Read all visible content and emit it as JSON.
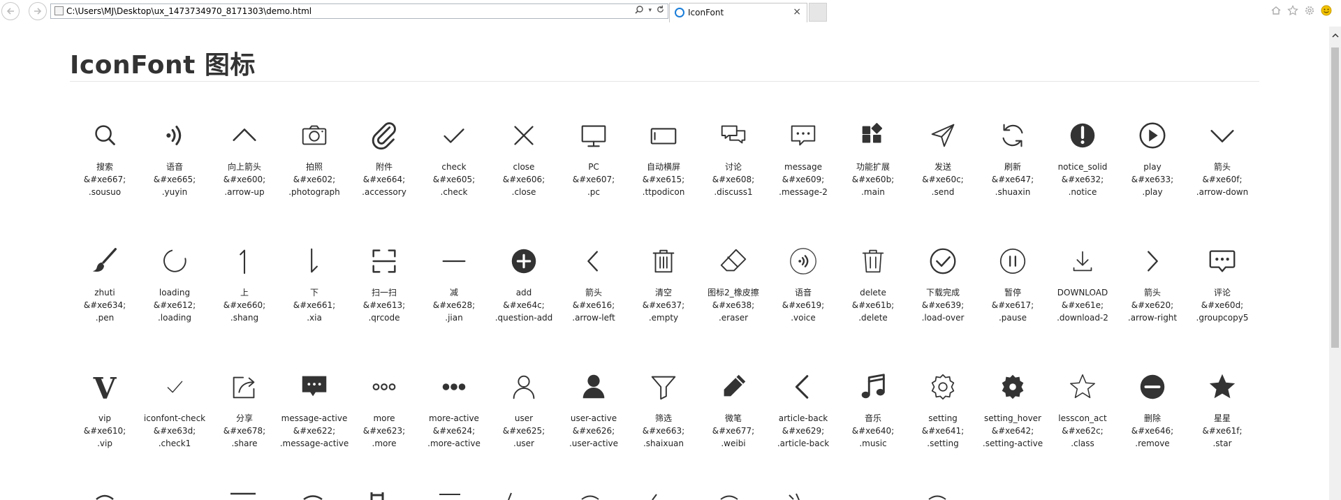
{
  "browser": {
    "address": "C:\\Users\\MJ\\Desktop\\ux_1473734970_8171303\\demo.html",
    "tab_title": "IconFont",
    "tab_close": "×"
  },
  "page": {
    "title": "IconFont 图标"
  },
  "icons": [
    {
      "name": "搜索",
      "code": "&#xe667;",
      "cls": ".sousuo",
      "icon": "search"
    },
    {
      "name": "语音",
      "code": "&#xe665;",
      "cls": ".yuyin",
      "icon": "voice-waves"
    },
    {
      "name": "向上箭头",
      "code": "&#xe600;",
      "cls": ".arrow-up",
      "icon": "arrow-up"
    },
    {
      "name": "拍照",
      "code": "&#xe602;",
      "cls": ".photograph",
      "icon": "camera"
    },
    {
      "name": "附件",
      "code": "&#xe664;",
      "cls": ".accessory",
      "icon": "paperclip"
    },
    {
      "name": "check",
      "code": "&#xe605;",
      "cls": ".check",
      "icon": "check"
    },
    {
      "name": "close",
      "code": "&#xe606;",
      "cls": ".close",
      "icon": "close"
    },
    {
      "name": "PC",
      "code": "&#xe607;",
      "cls": ".pc",
      "icon": "monitor"
    },
    {
      "name": "自动横屏",
      "code": "&#xe615;",
      "cls": ".ttpodicon",
      "icon": "landscape"
    },
    {
      "name": "讨论",
      "code": "&#xe608;",
      "cls": ".discuss1",
      "icon": "discuss"
    },
    {
      "name": "message",
      "code": "&#xe609;",
      "cls": ".message-2",
      "icon": "message"
    },
    {
      "name": "功能扩展",
      "code": "&#xe60b;",
      "cls": ".main",
      "icon": "apps"
    },
    {
      "name": "发送",
      "code": "&#xe60c;",
      "cls": ".send",
      "icon": "send"
    },
    {
      "name": "刷新",
      "code": "&#xe647;",
      "cls": ".shuaxin",
      "icon": "refresh"
    },
    {
      "name": "notice_solid",
      "code": "&#xe632;",
      "cls": ".notice",
      "icon": "notice"
    },
    {
      "name": "play",
      "code": "&#xe633;",
      "cls": ".play",
      "icon": "play"
    },
    {
      "name": "箭头",
      "code": "&#xe60f;",
      "cls": ".arrow-down",
      "icon": "chevron-down"
    },
    {
      "name": "zhuti",
      "code": "&#xe634;",
      "cls": ".pen",
      "icon": "brush"
    },
    {
      "name": "loading",
      "code": "&#xe612;",
      "cls": ".loading",
      "icon": "loading"
    },
    {
      "name": "上",
      "code": "&#xe660;",
      "cls": ".shang",
      "icon": "up-stroke"
    },
    {
      "name": "下",
      "code": "&#xe661;",
      "cls": ".xia",
      "icon": "down-stroke"
    },
    {
      "name": "扫一扫",
      "code": "&#xe613;",
      "cls": ".qrcode",
      "icon": "scan"
    },
    {
      "name": "减",
      "code": "&#xe628;",
      "cls": ".jian",
      "icon": "minus"
    },
    {
      "name": "add",
      "code": "&#xe64c;",
      "cls": ".question-add",
      "icon": "add"
    },
    {
      "name": "箭头",
      "code": "&#xe616;",
      "cls": ".arrow-left",
      "icon": "chevron-left"
    },
    {
      "name": "清空",
      "code": "&#xe637;",
      "cls": ".empty",
      "icon": "trash"
    },
    {
      "name": "图标2_橡皮擦",
      "code": "&#xe638;",
      "cls": ".eraser",
      "icon": "eraser"
    },
    {
      "name": "语音",
      "code": "&#xe619;",
      "cls": ".voice",
      "icon": "voice-circle"
    },
    {
      "name": "delete",
      "code": "&#xe61b;",
      "cls": ".delete",
      "icon": "trash-outline"
    },
    {
      "name": "下载完成",
      "code": "&#xe639;",
      "cls": ".load-over",
      "icon": "check-circle"
    },
    {
      "name": "暂停",
      "code": "&#xe617;",
      "cls": ".pause",
      "icon": "pause"
    },
    {
      "name": "DOWNLOAD",
      "code": "&#xe61e;",
      "cls": ".download-2",
      "icon": "download"
    },
    {
      "name": "箭头",
      "code": "&#xe620;",
      "cls": ".arrow-right",
      "icon": "chevron-right"
    },
    {
      "name": "评论",
      "code": "&#xe60d;",
      "cls": ".groupcopy5",
      "icon": "comment"
    },
    {
      "name": "vip",
      "code": "&#xe610;",
      "cls": ".vip",
      "icon": "vip"
    },
    {
      "name": "iconfont-check",
      "code": "&#xe63d;",
      "cls": ".check1",
      "icon": "check-thin"
    },
    {
      "name": "分享",
      "code": "&#xe678;",
      "cls": ".share",
      "icon": "share"
    },
    {
      "name": "message-active",
      "code": "&#xe622;",
      "cls": ".message-active",
      "icon": "message-solid"
    },
    {
      "name": "more",
      "code": "&#xe623;",
      "cls": ".more",
      "icon": "more"
    },
    {
      "name": "more-active",
      "code": "&#xe624;",
      "cls": ".more-active",
      "icon": "more-solid"
    },
    {
      "name": "user",
      "code": "&#xe625;",
      "cls": ".user",
      "icon": "user"
    },
    {
      "name": "user-active",
      "code": "&#xe626;",
      "cls": ".user-active",
      "icon": "user-solid"
    },
    {
      "name": "筛选",
      "code": "&#xe663;",
      "cls": ".shaixuan",
      "icon": "filter"
    },
    {
      "name": "微笔",
      "code": "&#xe677;",
      "cls": ".weibi",
      "icon": "pencil"
    },
    {
      "name": "article-back",
      "code": "&#xe629;",
      "cls": ".article-back",
      "icon": "back"
    },
    {
      "name": "音乐",
      "code": "&#xe640;",
      "cls": ".music",
      "icon": "music"
    },
    {
      "name": "setting",
      "code": "&#xe641;",
      "cls": ".setting",
      "icon": "gear"
    },
    {
      "name": "setting_hover",
      "code": "&#xe642;",
      "cls": ".setting-active",
      "icon": "gear-solid"
    },
    {
      "name": "lesscon_act",
      "code": "&#xe62c;",
      "cls": ".class",
      "icon": "star-outline"
    },
    {
      "name": "删除",
      "code": "&#xe646;",
      "cls": ".remove",
      "icon": "remove"
    },
    {
      "name": "星星",
      "code": "&#xe61f;",
      "cls": ".star",
      "icon": "star"
    }
  ]
}
